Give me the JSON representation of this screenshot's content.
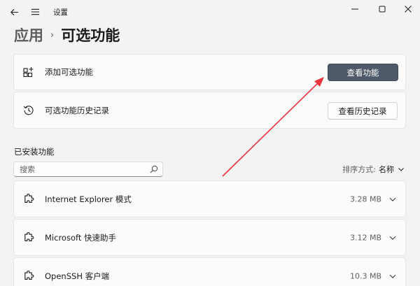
{
  "window": {
    "title": "设置"
  },
  "breadcrumb": {
    "parent": "应用",
    "separator": "›",
    "current": "可选功能"
  },
  "add_feature": {
    "label": "添加可选功能",
    "button": "查看功能",
    "icon": "add-feature-icon"
  },
  "history": {
    "label": "可选功能历史记录",
    "button": "查看历史记录",
    "icon": "history-icon"
  },
  "installed": {
    "title": "已安装功能",
    "search_placeholder": "搜索",
    "sort_label": "排序方式:",
    "sort_value": "名称",
    "features": [
      {
        "name": "Internet Explorer 模式",
        "size": "3.28 MB"
      },
      {
        "name": "Microsoft 快速助手",
        "size": "3.12 MB"
      },
      {
        "name": "OpenSSH 客户端",
        "size": "10.3 MB"
      }
    ]
  },
  "colors": {
    "background": "#f3f3f3",
    "card": "#fbfbfb",
    "primary_button": "#4e5a69",
    "annotation_arrow": "#e8343a"
  }
}
